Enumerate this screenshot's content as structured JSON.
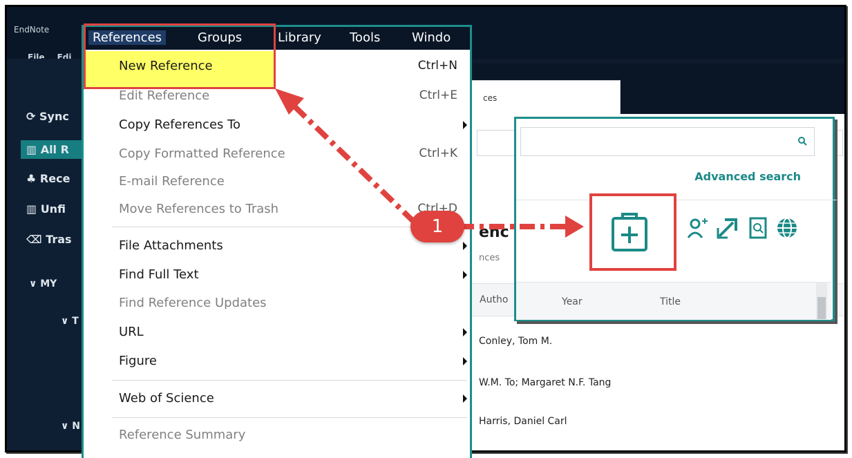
{
  "app": {
    "title": "EndNote",
    "menus_bg": [
      "File",
      "Edi"
    ]
  },
  "menubar": {
    "items": [
      "References",
      "Groups",
      "Library",
      "Tools",
      "Windo"
    ]
  },
  "references_menu": {
    "items": [
      {
        "label": "New Reference",
        "shortcut": "Ctrl+N",
        "enabled": true
      },
      {
        "label": "Edit Reference",
        "shortcut": "Ctrl+E",
        "enabled": false
      },
      {
        "label": "Copy References To",
        "shortcut": "",
        "enabled": true,
        "submenu": true
      },
      {
        "label": "Copy Formatted Reference",
        "shortcut": "Ctrl+K",
        "enabled": false
      },
      {
        "label": "E-mail Reference",
        "shortcut": "",
        "enabled": false
      },
      {
        "label": "Move References to Trash",
        "shortcut": "Ctrl+D",
        "enabled": false
      },
      {
        "label": "File Attachments",
        "shortcut": "",
        "enabled": true,
        "submenu": true
      },
      {
        "label": "Find Full Text",
        "shortcut": "",
        "enabled": true,
        "submenu": true
      },
      {
        "label": "Find Reference Updates",
        "shortcut": "",
        "enabled": false
      },
      {
        "label": "URL",
        "shortcut": "",
        "enabled": true,
        "submenu": true
      },
      {
        "label": "Figure",
        "shortcut": "",
        "enabled": true,
        "submenu": true
      },
      {
        "label": "Web of Science",
        "shortcut": "",
        "enabled": true,
        "submenu": true
      },
      {
        "label": "Reference Summary",
        "shortcut": "",
        "enabled": false
      }
    ]
  },
  "sidebar": {
    "items": [
      "Sync",
      "All R",
      "Rece",
      "Unfi",
      "Tras"
    ],
    "group_header": "MY",
    "sub": [
      "T",
      "N"
    ]
  },
  "main": {
    "tab_label": "ces",
    "search_placeholder": "",
    "advanced_search": "Advanced search",
    "section_title": "enc",
    "section_sub": "nces",
    "columns": [
      "Autho",
      "Year",
      "Title"
    ],
    "rows": [
      "Conley, Tom M.",
      "W.M. To; Margaret N.F. Tang",
      "Harris, Daniel Carl"
    ]
  },
  "annotation": {
    "step_number": "1",
    "accent_color": "#e0433f",
    "teal_color": "#1c8e8b"
  },
  "icons": [
    "new-reference-icon",
    "add-user-icon",
    "share-arrow-icon",
    "pdf-search-icon",
    "globe-icon",
    "search-icon"
  ]
}
